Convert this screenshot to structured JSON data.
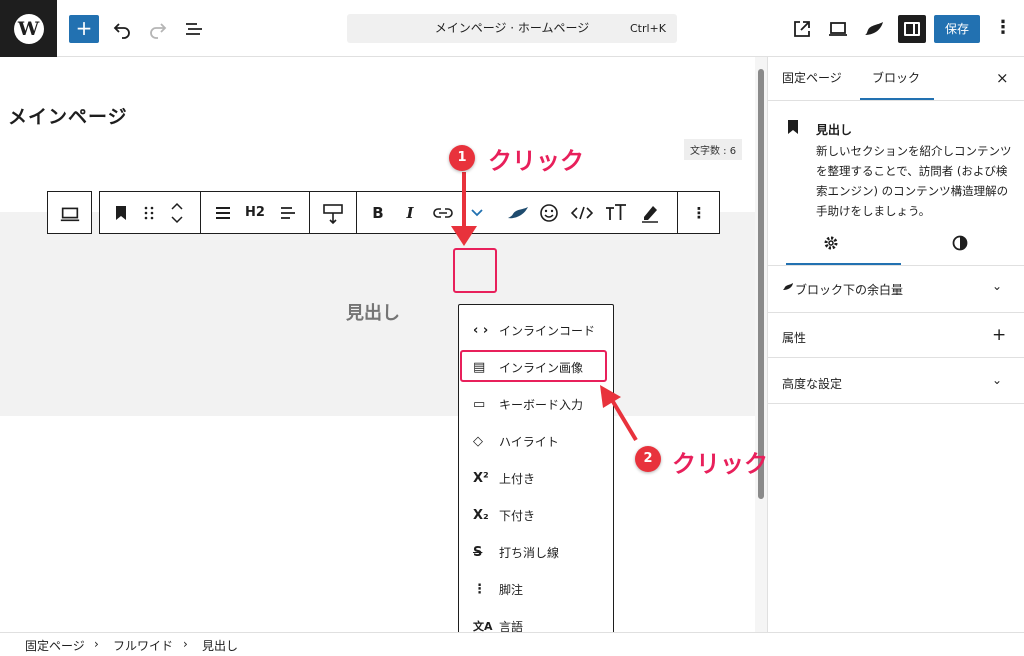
{
  "header": {
    "logo": "W",
    "add_label": "+",
    "document_title": "メインページ · ホームページ",
    "shortcut": "Ctrl+K",
    "save_label": "保存",
    "more_label": "⋮"
  },
  "editor": {
    "page_title": "メインページ",
    "char_count": "文字数 : 6",
    "heading_text": "見出し",
    "toolbar": {
      "heading_level": "H2",
      "bold": "B",
      "italic": "I",
      "more": "⋮"
    }
  },
  "dropdown": {
    "items": [
      {
        "icon": "‹ ›",
        "label": "インラインコード"
      },
      {
        "icon": "▤",
        "label": "インライン画像"
      },
      {
        "icon": "▭",
        "label": "キーボード入力"
      },
      {
        "icon": "◇",
        "label": "ハイライト"
      },
      {
        "icon": "X²",
        "label": "上付き"
      },
      {
        "icon": "X₂",
        "label": "下付き"
      },
      {
        "icon": "S",
        "label": "打ち消し線"
      },
      {
        "icon": "⋮",
        "label": "脚注"
      },
      {
        "icon": "文A",
        "label": "言語"
      }
    ]
  },
  "sidebar": {
    "tabs": [
      "固定ページ",
      "ブロック"
    ],
    "close": "×",
    "block_title": "見出し",
    "block_description": "新しいセクションを紹介しコンテンツを整理することで、訪問者 (および検索エンジン) のコンテンツ構造理解の手助けをしましょう。",
    "panels": [
      {
        "label": "ブロック下の余白量",
        "indicator": "⌄"
      },
      {
        "label": "属性",
        "indicator": "+"
      },
      {
        "label": "高度な設定",
        "indicator": "⌄"
      }
    ]
  },
  "breadcrumb": {
    "items": [
      "固定ページ",
      "フルワイド",
      "見出し"
    ],
    "separator": "›"
  },
  "annotations": {
    "step1": {
      "number": "1",
      "text": "クリック"
    },
    "step2": {
      "number": "2",
      "text": "クリック"
    }
  },
  "colors": {
    "accent": "#2271b1",
    "annotation": "#e8205b",
    "dark": "#1e1e1e"
  }
}
